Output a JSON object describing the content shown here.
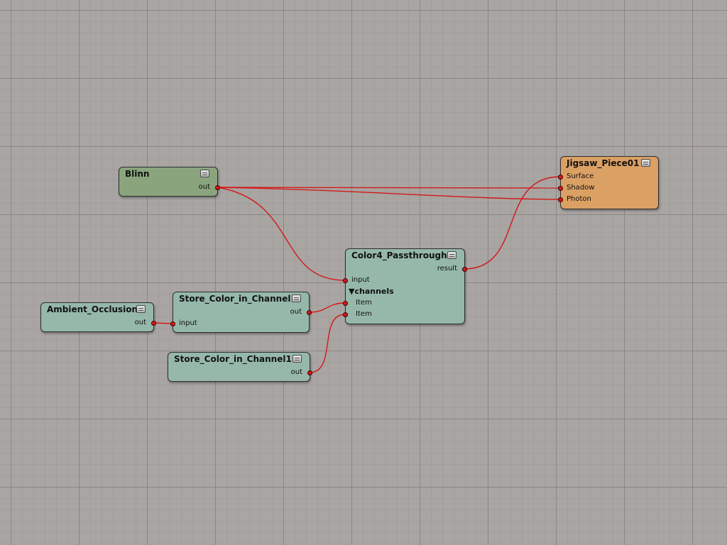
{
  "graph": {
    "wire_color": "#d11a1a",
    "nodes": {
      "blinn": {
        "title": "Blinn",
        "color": "#8aa57e",
        "out_label": "out"
      },
      "jigsaw": {
        "title": "Jigsaw_Piece01",
        "color": "#dba064",
        "inputs": [
          "Surface",
          "Shadow",
          "Photon"
        ]
      },
      "color4_passthrough": {
        "title": "Color4_Passthrough",
        "color": "#95b8aa",
        "result_label": "result",
        "input_label": "input",
        "channels_label": "channels",
        "items": [
          "Item",
          "Item"
        ]
      },
      "ambient_occlusion": {
        "title": "Ambient_Occlusion",
        "color": "#95b8aa",
        "out_label": "out"
      },
      "store_color": {
        "title": "Store_Color_in_Channel",
        "color": "#95b8aa",
        "out_label": "out",
        "input_label": "input"
      },
      "store_color1": {
        "title": "Store_Color_in_Channel1",
        "color": "#95b8aa",
        "out_label": "out"
      }
    },
    "connections": [
      {
        "from": "Blinn.out",
        "to": "Jigsaw_Piece01.Shadow"
      },
      {
        "from": "Blinn.out",
        "to": "Jigsaw_Piece01.Photon"
      },
      {
        "from": "Blinn.out",
        "to": "Color4_Passthrough.input"
      },
      {
        "from": "Color4_Passthrough.result",
        "to": "Jigsaw_Piece01.Surface"
      },
      {
        "from": "Ambient_Occlusion.out",
        "to": "Store_Color_in_Channel.input"
      },
      {
        "from": "Store_Color_in_Channel.out",
        "to": "Color4_Passthrough.channels.Item"
      },
      {
        "from": "Store_Color_in_Channel1.out",
        "to": "Color4_Passthrough.channels.Item"
      }
    ]
  }
}
